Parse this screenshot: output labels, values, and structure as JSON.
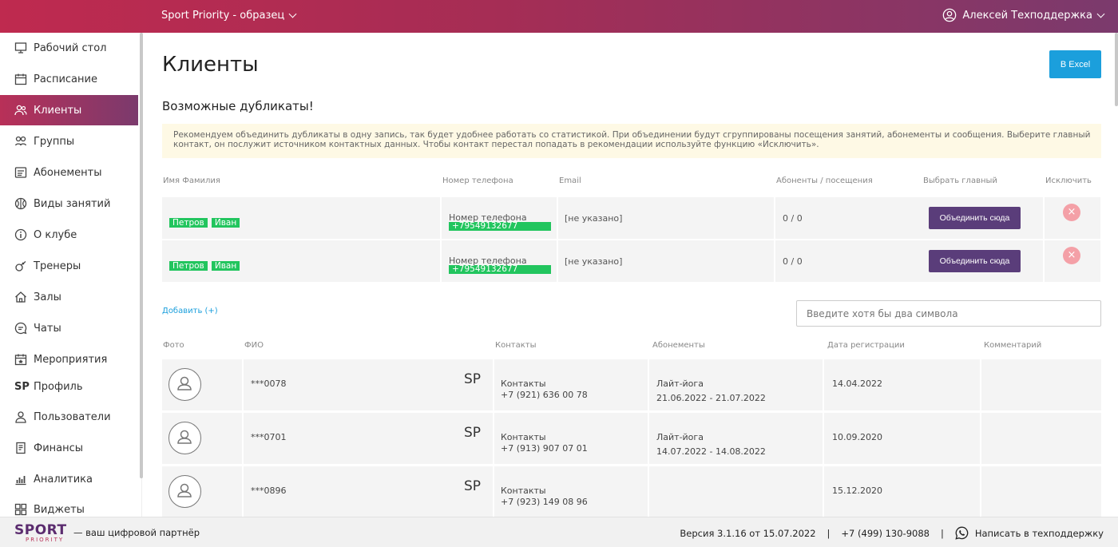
{
  "topbar": {
    "org_label": "Sport Priority - образец",
    "user_label": "Алексей Техподдержка"
  },
  "sidebar": {
    "items": [
      {
        "label": "Рабочий стол",
        "icon": "monitor-icon"
      },
      {
        "label": "Расписание",
        "icon": "calendar-icon"
      },
      {
        "label": "Клиенты",
        "icon": "users-icon",
        "active": true
      },
      {
        "label": "Группы",
        "icon": "group-icon"
      },
      {
        "label": "Абонементы",
        "icon": "card-icon"
      },
      {
        "label": "Виды занятий",
        "icon": "ball-icon"
      },
      {
        "label": "О клубе",
        "icon": "info-icon"
      },
      {
        "label": "Тренеры",
        "icon": "whistle-icon"
      },
      {
        "label": "Залы",
        "icon": "home-icon"
      },
      {
        "label": "Чаты",
        "icon": "chat-icon"
      },
      {
        "label": "Мероприятия",
        "icon": "event-icon"
      },
      {
        "label": "Профиль",
        "icon": "sp-icon"
      },
      {
        "label": "Пользователи",
        "icon": "user-icon"
      },
      {
        "label": "Финансы",
        "icon": "document-icon"
      },
      {
        "label": "Аналитика",
        "icon": "chart-icon"
      },
      {
        "label": "Виджеты",
        "icon": "widgets-icon"
      }
    ]
  },
  "main": {
    "title": "Клиенты",
    "excel_label": "В Excel",
    "duplicates_title": "Возможные дубликаты!",
    "warning_text": "Рекомендуем объединить дубликаты в одну запись, так будет удобнее работать со статистикой. При объединении будут сгруппированы посещения занятий, абонементы и сообщения. Выберите главный контакт, он послужит источником контактных данных. Чтобы контакт перестал попадать в рекомендации используйте функцию «Исключить».",
    "dup_headers": [
      "Имя Фамилия",
      "Номер телефона",
      "Email",
      "Абоненты / посещения",
      "Выбрать главный",
      "Исключить"
    ],
    "dup_rows": [
      {
        "first": "Петров",
        "last": "Иван",
        "phone_label": "Номер телефона",
        "phone": "+79549132677",
        "email": "[не указано]",
        "visits": "0 / 0",
        "merge_label": "Объединить сюда",
        "exclude": "×"
      },
      {
        "first": "Петров",
        "last": "Иван",
        "phone_label": "Номер телефона",
        "phone": "+79549132677",
        "email": "[не указано]",
        "visits": "0 / 0",
        "merge_label": "Объединить сюда",
        "exclude": "×"
      }
    ],
    "add_label": "Добавить (+)",
    "search_placeholder": "Введите хотя бы два символа",
    "client_headers": [
      "Фото",
      "ФИО",
      "Контакты",
      "Абонементы",
      "Дата регистрации",
      "Комментарий"
    ],
    "clients": [
      {
        "name": "***0078",
        "sp": "SP",
        "contacts_label": "Контакты",
        "phone": "+7 (921) 636 00 78",
        "sub_name": "Лайт-йога",
        "sub_period": "21.06.2022 - 21.07.2022",
        "reg_date": "14.04.2022"
      },
      {
        "name": "***0701",
        "sp": "SP",
        "contacts_label": "Контакты",
        "phone": "+7 (913) 907 07 01",
        "sub_name": "Лайт-йога",
        "sub_period": "14.07.2022 - 14.08.2022",
        "reg_date": "10.09.2020"
      },
      {
        "name": "***0896",
        "sp": "SP",
        "contacts_label": "Контакты",
        "phone": "+7 (923) 149 08 96",
        "sub_name": "",
        "sub_period": "",
        "reg_date": "15.12.2020"
      }
    ]
  },
  "footer": {
    "brand_big": "SPORT",
    "brand_small": "PRIORITY",
    "tagline": "— ваш цифровой партнёр",
    "version": "Версия 3.1.16 от 15.07.2022",
    "sep": "|",
    "phone": "+7 (499) 130-9088",
    "support_label": "Написать в техподдержку"
  },
  "colors": {
    "accent": "#1b9fdc",
    "brand_from": "#bf2a4f",
    "brand_to": "#7b3a6d",
    "tag_green": "#22c55e",
    "merge": "#5a3d7a"
  }
}
